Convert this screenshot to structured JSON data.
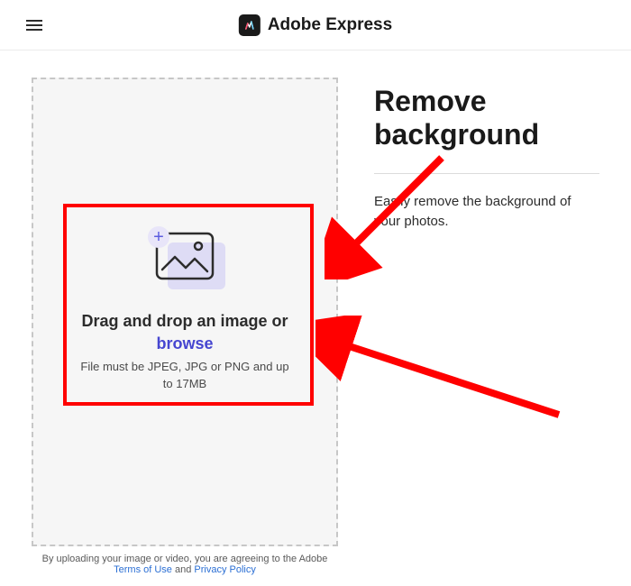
{
  "header": {
    "brand_name": "Adobe Express"
  },
  "drop_area": {
    "title": "Drag and drop an image or",
    "browse_label": "browse",
    "hint": "File must be JPEG, JPG or PNG and up to 17MB"
  },
  "info": {
    "title": "Remove background",
    "description": "Easily remove the background of your photos."
  },
  "footer": {
    "disclaimer_prefix": "By uploading your image or video, you are agreeing to the Adobe",
    "terms_label": "Terms of Use",
    "and_label": " and ",
    "privacy_label": "Privacy Policy"
  }
}
